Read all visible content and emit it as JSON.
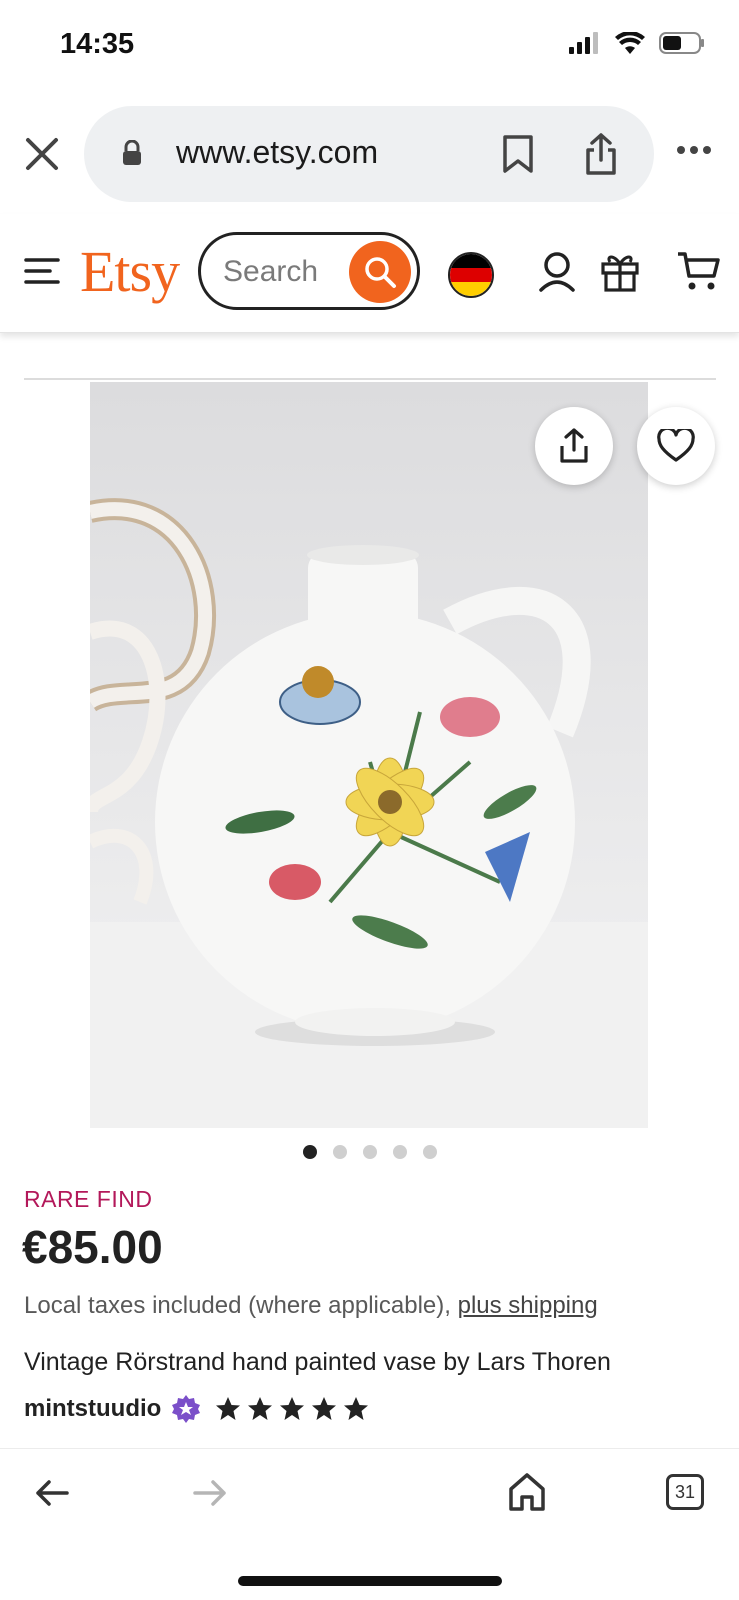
{
  "status_bar": {
    "time": "14:35"
  },
  "browser": {
    "url": "www.etsy.com",
    "icons": [
      "close-icon",
      "lock-icon",
      "bookmark-icon",
      "share-icon",
      "more-icon"
    ]
  },
  "etsy_header": {
    "logo": "Etsy",
    "search_placeholder": "Search",
    "accent_color": "#f1641e",
    "icons": [
      "menu-icon",
      "search-icon",
      "germany-flag-icon",
      "account-icon",
      "gift-icon",
      "cart-icon"
    ]
  },
  "gallery": {
    "image_count": 5,
    "active_index": 0,
    "image_alt": "Vintage white ceramic vase with hand-painted flowers"
  },
  "listing": {
    "badge": "RARE FIND",
    "price": "€85.00",
    "taxes_text": "Local taxes included (where applicable), ",
    "shipping_link": "plus shipping",
    "title": "Vintage Rörstrand hand painted vase by Lars Thoren",
    "shop_name": "mintstuudio",
    "rating": 5
  },
  "bottom_nav": {
    "tabs_count": "31",
    "icons": [
      "back-arrow-icon",
      "forward-arrow-icon",
      "home-icon",
      "tabs-icon"
    ]
  }
}
